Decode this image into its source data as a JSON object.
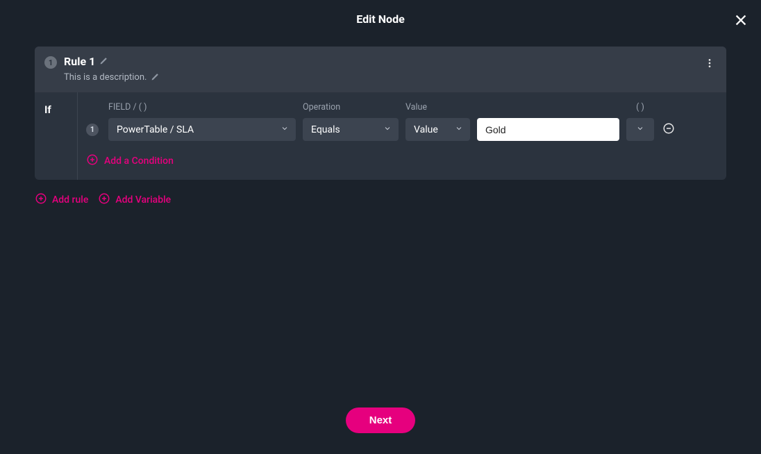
{
  "header": {
    "title": "Edit Node"
  },
  "rule": {
    "number": "1",
    "title": "Rule 1",
    "description": "This is a description."
  },
  "if_label": "If",
  "cond_headers": {
    "field": "FIELD / ( )",
    "operation": "Operation",
    "value_type": "Value",
    "paren": "( )"
  },
  "condition": {
    "row_num": "1",
    "field": "PowerTable / SLA",
    "operation": "Equals",
    "value_type": "Value",
    "value": "Gold"
  },
  "labels": {
    "add_condition": "Add a Condition",
    "add_rule": "Add rule",
    "add_variable": "Add Variable",
    "next": "Next"
  }
}
